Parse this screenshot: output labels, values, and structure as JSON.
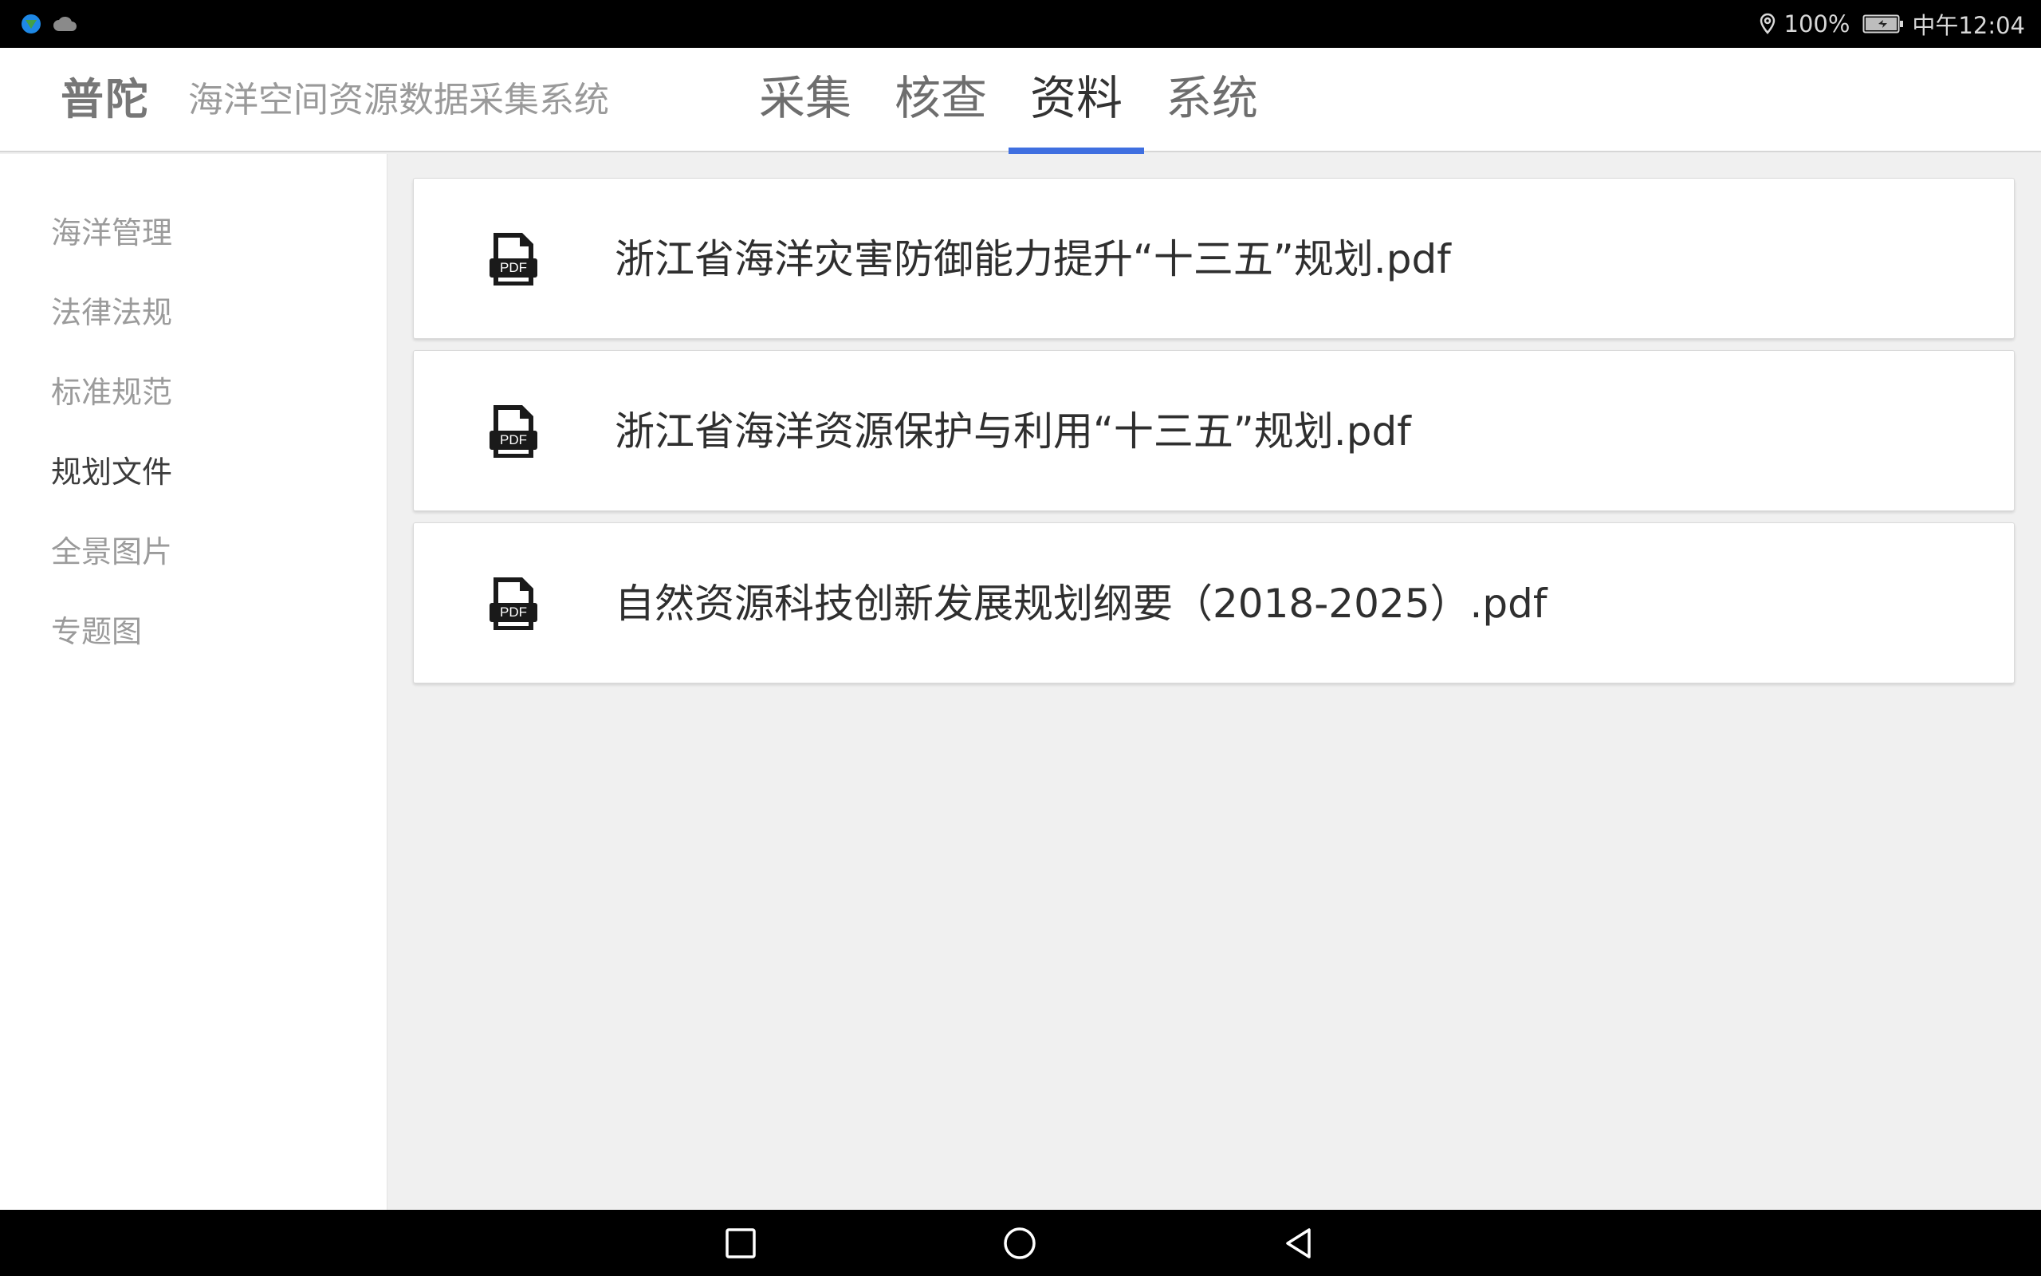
{
  "status_bar": {
    "left_icons": [
      "app-globe-icon",
      "cloud-icon"
    ],
    "location_icon": "location-pin-icon",
    "battery_percent": "100%",
    "battery_icon": "battery-charging-icon",
    "time": "中午12:04"
  },
  "header": {
    "brand": "普陀",
    "subtitle": "海洋空间资源数据采集系统",
    "tabs": [
      {
        "label": "采集",
        "active": false
      },
      {
        "label": "核查",
        "active": false
      },
      {
        "label": "资料",
        "active": true
      },
      {
        "label": "系统",
        "active": false
      }
    ]
  },
  "sidebar": {
    "items": [
      {
        "label": "海洋管理",
        "active": false
      },
      {
        "label": "法律法规",
        "active": false
      },
      {
        "label": "标准规范",
        "active": false
      },
      {
        "label": "规划文件",
        "active": true
      },
      {
        "label": "全景图片",
        "active": false
      },
      {
        "label": "专题图",
        "active": false
      }
    ]
  },
  "files": {
    "icon": "pdf-file-icon",
    "icon_label": "PDF",
    "items": [
      {
        "name": "浙江省海洋灾害防御能力提升“十三五”规划.pdf"
      },
      {
        "name": "浙江省海洋资源保护与利用“十三五”规划.pdf"
      },
      {
        "name": "自然资源科技创新发展规划纲要（2018-2025）.pdf"
      }
    ]
  },
  "nav_bar": {
    "buttons": [
      "recents-square-icon",
      "home-circle-icon",
      "back-triangle-icon"
    ]
  },
  "colors": {
    "accent": "#3f6fe0",
    "status_bar": "#000000",
    "content_bg": "#f0f0f0"
  }
}
